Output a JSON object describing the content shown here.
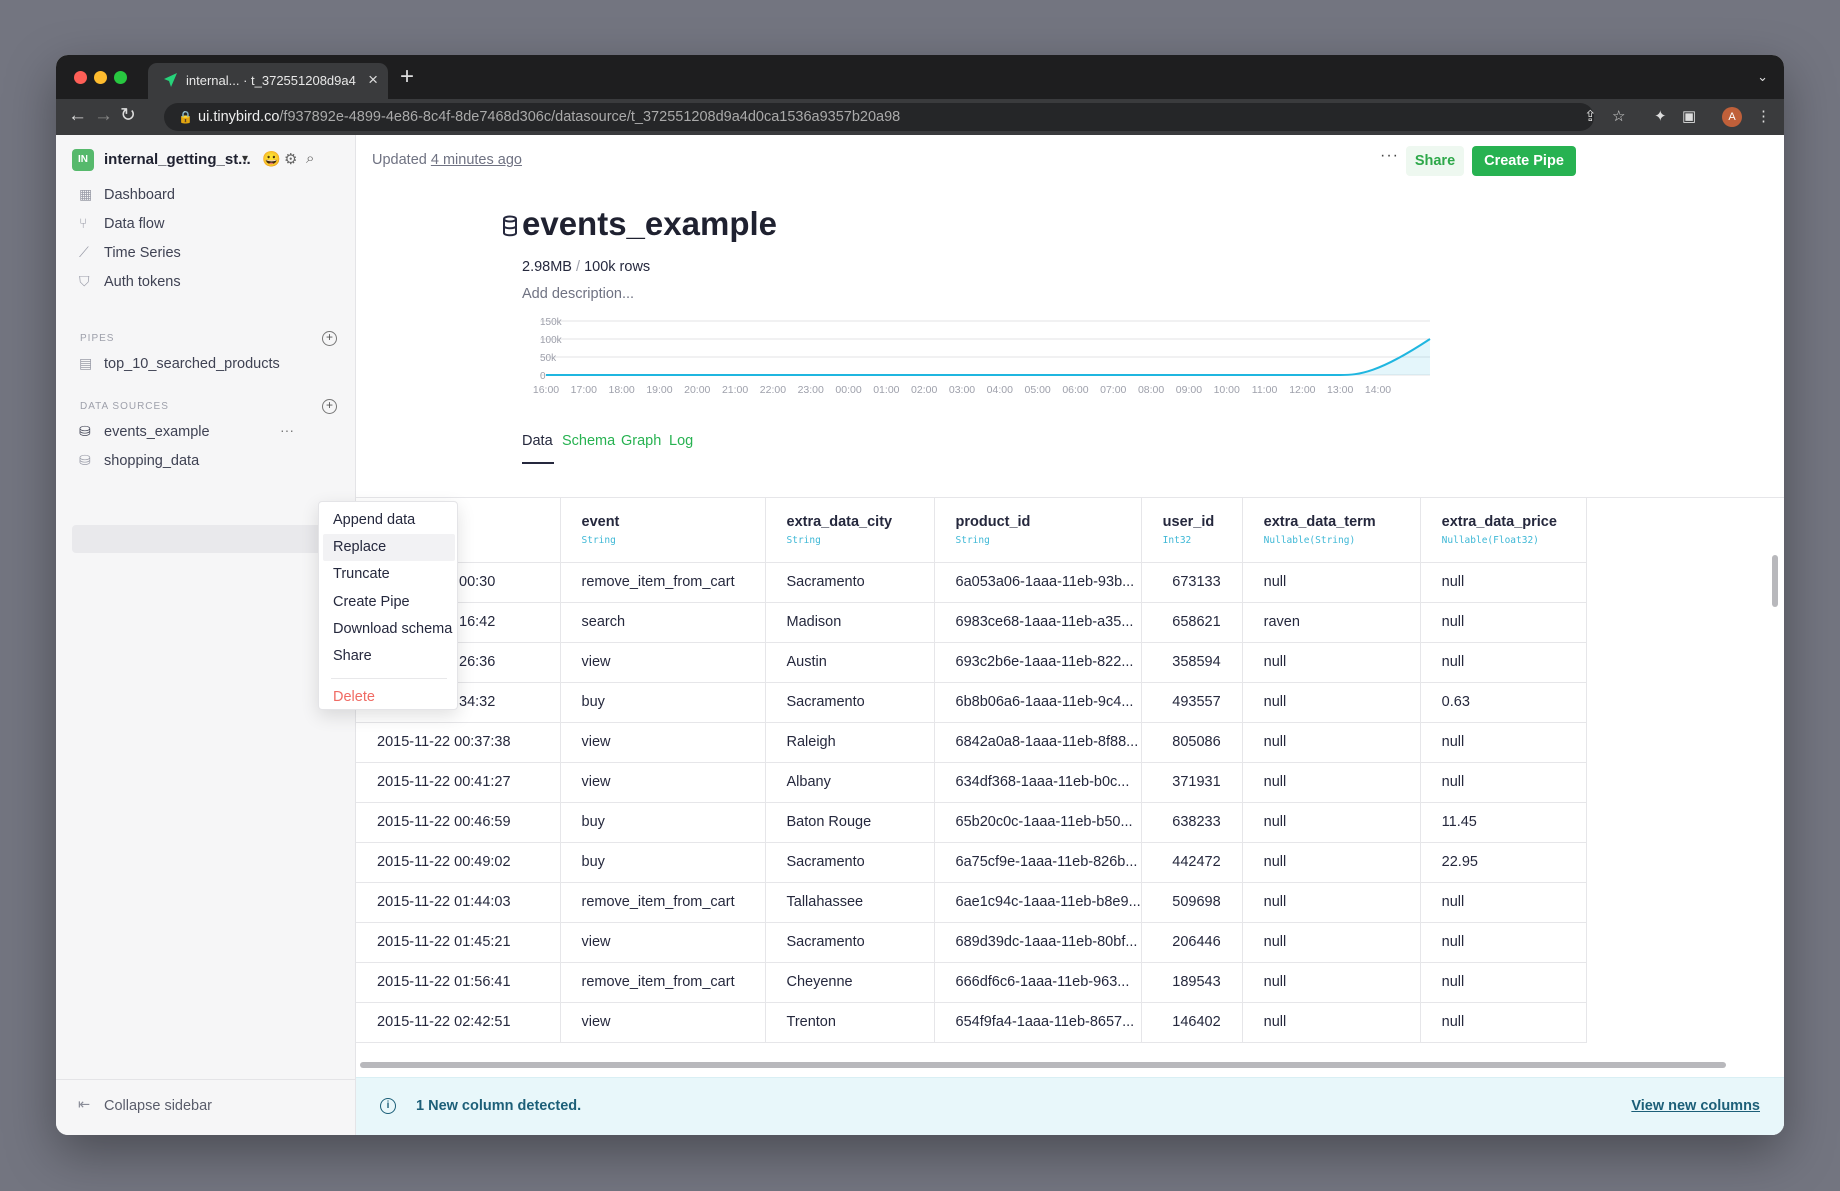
{
  "browser": {
    "tab_title": "internal... · t_372551208d9a4d",
    "url_host": "ui.tinybird.co",
    "url_path": "/f937892e-4899-4e86-8c4f-8de7468d306c/datasource/t_372551208d9a4d0ca1536a9357b20a98",
    "profile_initial": "A"
  },
  "sidebar": {
    "workspace_badge": "IN",
    "workspace_name": "internal_getting_st...",
    "nav": [
      {
        "label": "Dashboard",
        "icon": "grid-icon"
      },
      {
        "label": "Data flow",
        "icon": "data-flow-icon"
      },
      {
        "label": "Time Series",
        "icon": "chart-line-icon"
      },
      {
        "label": "Auth tokens",
        "icon": "shield-icon"
      }
    ],
    "pipes_header": "PIPES",
    "pipes": [
      "top_10_searched_products"
    ],
    "datasources_header": "DATA SOURCES",
    "datasources": [
      "events_example",
      "shopping_data"
    ],
    "collapse_label": "Collapse sidebar"
  },
  "context_menu": {
    "items": [
      "Append data",
      "Replace",
      "Truncate",
      "Create Pipe",
      "Download schema",
      "Share"
    ],
    "delete": "Delete"
  },
  "header": {
    "updated_prefix": "Updated",
    "updated_time": "4 minutes ago",
    "more": "···",
    "share": "Share",
    "create_pipe": "Create Pipe"
  },
  "datasource": {
    "name": "events_example",
    "size": "2.98MB",
    "separator": "/",
    "rows": "100k rows",
    "description_placeholder": "Add description..."
  },
  "chart_data": {
    "type": "area",
    "y_ticks": [
      "150k",
      "100k",
      "50k",
      "0"
    ],
    "ylim": [
      0,
      150000
    ],
    "x": [
      "16:00",
      "17:00",
      "18:00",
      "19:00",
      "20:00",
      "21:00",
      "22:00",
      "23:00",
      "00:00",
      "01:00",
      "02:00",
      "03:00",
      "04:00",
      "05:00",
      "06:00",
      "07:00",
      "08:00",
      "09:00",
      "10:00",
      "11:00",
      "12:00",
      "13:00",
      "14:00"
    ],
    "values": [
      0,
      0,
      0,
      0,
      0,
      0,
      0,
      0,
      0,
      0,
      0,
      0,
      0,
      0,
      0,
      0,
      0,
      0,
      0,
      0,
      0,
      0,
      20000
    ],
    "end_value": 100000,
    "color": "#1fb6e0",
    "grid": true
  },
  "tabs": [
    "Data",
    "Schema",
    "Graph",
    "Log"
  ],
  "table": {
    "columns": [
      {
        "name": "",
        "type": ""
      },
      {
        "name": "event",
        "type": "String"
      },
      {
        "name": "extra_data_city",
        "type": "String"
      },
      {
        "name": "product_id",
        "type": "String"
      },
      {
        "name": "user_id",
        "type": "Int32"
      },
      {
        "name": "extra_data_term",
        "type": "Nullable(String)"
      },
      {
        "name": "extra_data_price",
        "type": "Nullable(Float32)"
      }
    ],
    "rows": [
      [
        ":00:30",
        "remove_item_from_cart",
        "Sacramento",
        "6a053a06-1aaa-11eb-93b...",
        "673133",
        "null",
        "null"
      ],
      [
        ":16:42",
        "search",
        "Madison",
        "6983ce68-1aaa-11eb-a35...",
        "658621",
        "raven",
        "null"
      ],
      [
        ":26:36",
        "view",
        "Austin",
        "693c2b6e-1aaa-11eb-822...",
        "358594",
        "null",
        "null"
      ],
      [
        ":34:32",
        "buy",
        "Sacramento",
        "6b8b06a6-1aaa-11eb-9c4...",
        "493557",
        "null",
        "0.63"
      ],
      [
        "2015-11-22 00:37:38",
        "view",
        "Raleigh",
        "6842a0a8-1aaa-11eb-8f88...",
        "805086",
        "null",
        "null"
      ],
      [
        "2015-11-22 00:41:27",
        "view",
        "Albany",
        "634df368-1aaa-11eb-b0c...",
        "371931",
        "null",
        "null"
      ],
      [
        "2015-11-22 00:46:59",
        "buy",
        "Baton Rouge",
        "65b20c0c-1aaa-11eb-b50...",
        "638233",
        "null",
        "11.45"
      ],
      [
        "2015-11-22 00:49:02",
        "buy",
        "Sacramento",
        "6a75cf9e-1aaa-11eb-826b...",
        "442472",
        "null",
        "22.95"
      ],
      [
        "2015-11-22 01:44:03",
        "remove_item_from_cart",
        "Tallahassee",
        "6ae1c94c-1aaa-11eb-b8e9...",
        "509698",
        "null",
        "null"
      ],
      [
        "2015-11-22 01:45:21",
        "view",
        "Sacramento",
        "689d39dc-1aaa-11eb-80bf...",
        "206446",
        "null",
        "null"
      ],
      [
        "2015-11-22 01:56:41",
        "remove_item_from_cart",
        "Cheyenne",
        "666df6c6-1aaa-11eb-963...",
        "189543",
        "null",
        "null"
      ],
      [
        "2015-11-22 02:42:51",
        "view",
        "Trenton",
        "654f9fa4-1aaa-11eb-8657...",
        "146402",
        "null",
        "null"
      ]
    ]
  },
  "banner": {
    "icon": "info-icon",
    "text": "1 New column detected.",
    "link": "View new columns"
  }
}
